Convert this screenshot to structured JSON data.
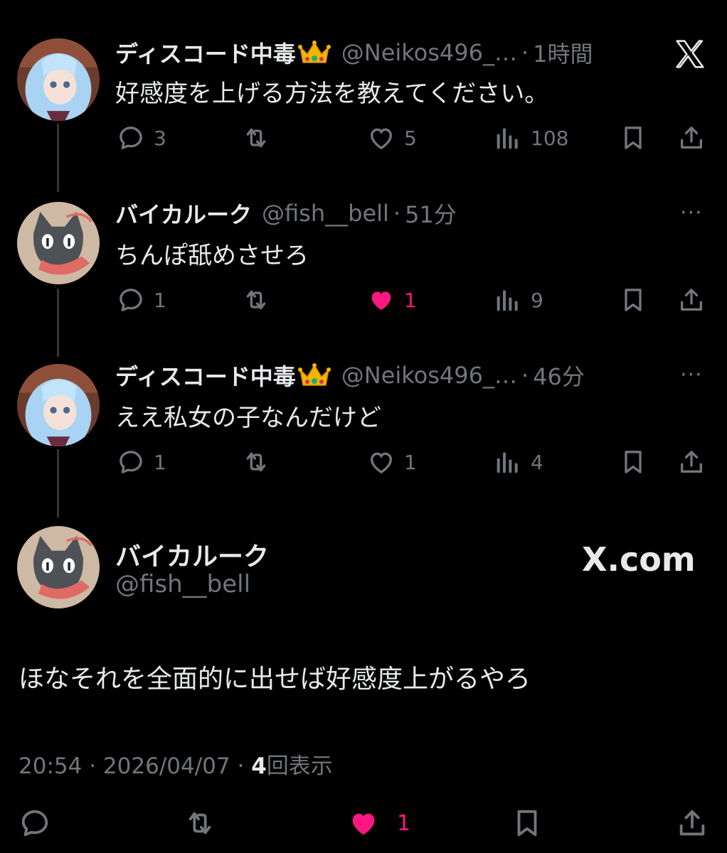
{
  "colors": {
    "background": "#000000",
    "text": "#e7e9ea",
    "muted": "#71767b",
    "like": "#f91880",
    "thread_line": "#333639"
  },
  "tweets": [
    {
      "name": "ディスコード中毒",
      "badge_icon": "crown-icon",
      "handle": "@Neikos496_…",
      "sep": "·",
      "time": "1時間",
      "text": "好感度を上げる方法を教えてください。",
      "replies": "3",
      "likes": "5",
      "liked": false,
      "views": "108"
    },
    {
      "name": "バイカルーク",
      "handle": "@fish__bell",
      "sep": "·",
      "time": "51分",
      "text": "ちんぽ舐めさせろ",
      "replies": "1",
      "likes": "1",
      "liked": true,
      "views": "9"
    },
    {
      "name": "ディスコード中毒",
      "badge_icon": "crown-icon",
      "handle": "@Neikos496_…",
      "sep": "·",
      "time": "46分",
      "text": "ええ私女の子なんだけど",
      "replies": "1",
      "likes": "1",
      "liked": false,
      "views": "4"
    }
  ],
  "focused": {
    "name": "バイカルーク",
    "handle": "@fish__bell",
    "text": "ほなそれを全面的に出せば好感度上がるやろ",
    "time": "20:54",
    "sep1": "·",
    "date": "2026/04/07",
    "sep2": "·",
    "views": "4",
    "views_label": "回表示",
    "likes": "1",
    "liked": true
  },
  "watermark": "X.com",
  "more_label": "···"
}
